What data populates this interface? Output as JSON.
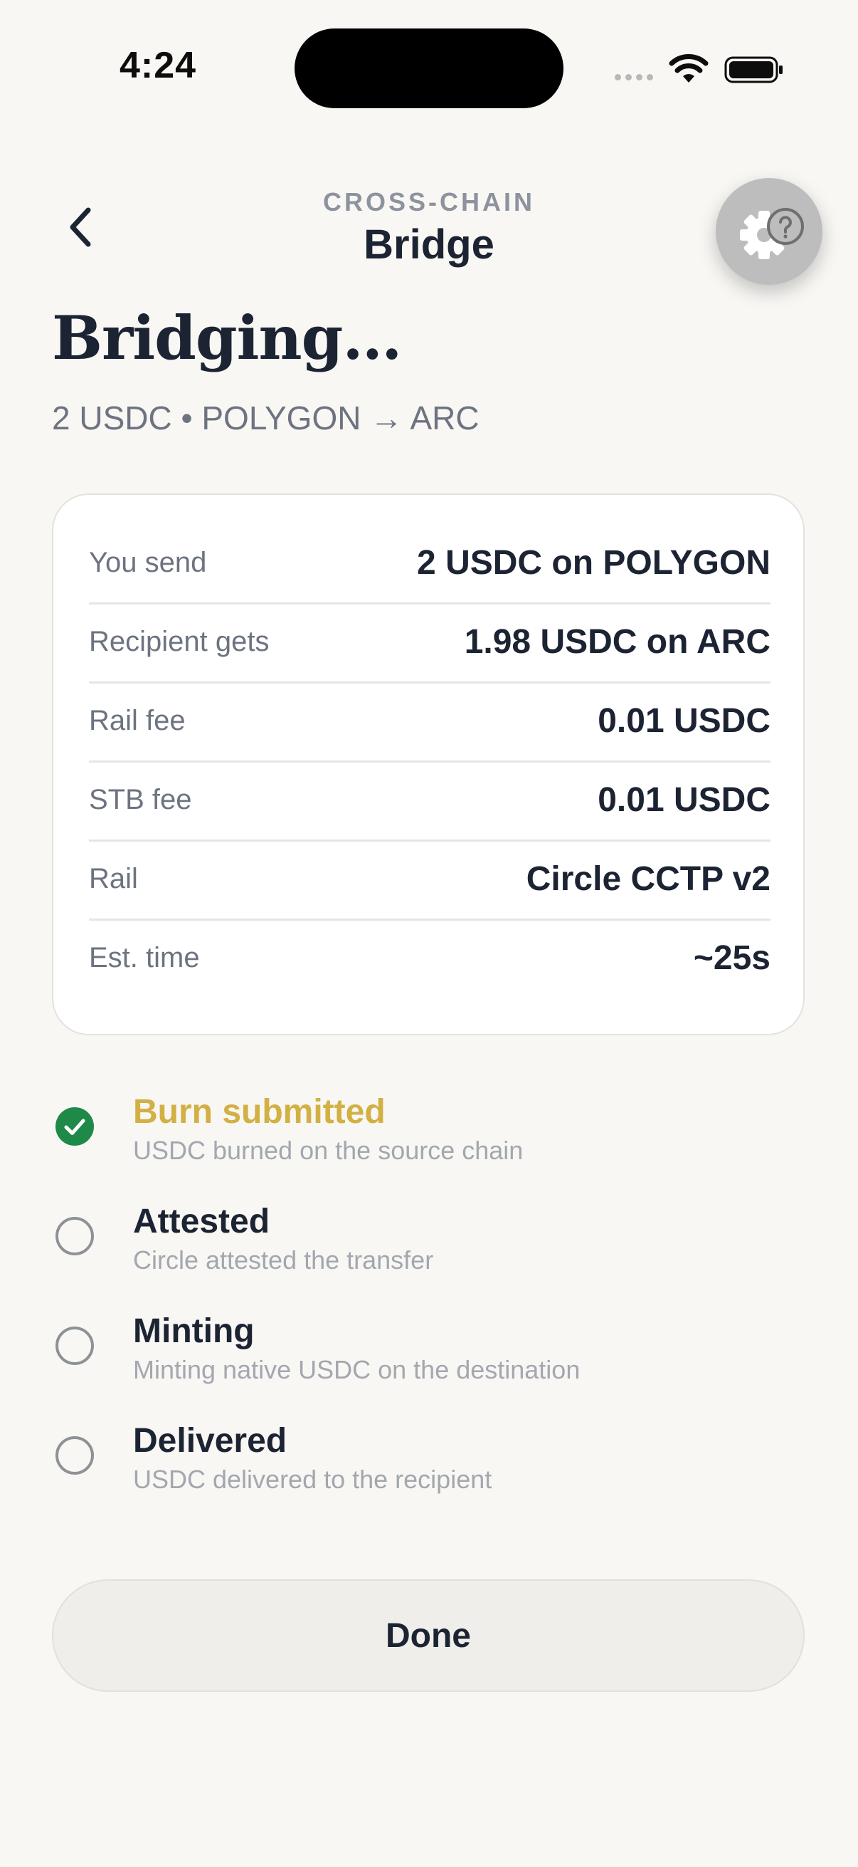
{
  "status_bar": {
    "time": "4:24"
  },
  "header": {
    "eyebrow": "CROSS-CHAIN",
    "title": "Bridge",
    "back_icon": "chevron-left-icon",
    "settings_icon": "gear-help-icon"
  },
  "page": {
    "heading": "Bridging…",
    "subtitle": "2 USDC • POLYGON → ARC"
  },
  "summary": {
    "rows": [
      {
        "label": "You send",
        "value": "2 USDC on POLYGON"
      },
      {
        "label": "Recipient gets",
        "value": "1.98 USDC on ARC"
      },
      {
        "label": "Rail fee",
        "value": "0.01 USDC"
      },
      {
        "label": "STB fee",
        "value": "0.01 USDC"
      },
      {
        "label": "Rail",
        "value": "Circle CCTP v2"
      },
      {
        "label": "Est. time",
        "value": "~25s"
      }
    ]
  },
  "steps": [
    {
      "title": "Burn submitted",
      "description": "USDC burned on the source chain",
      "state": "complete"
    },
    {
      "title": "Attested",
      "description": "Circle attested the transfer",
      "state": "pending"
    },
    {
      "title": "Minting",
      "description": "Minting native USDC on the destination",
      "state": "pending"
    },
    {
      "title": "Delivered",
      "description": "USDC delivered to the recipient",
      "state": "pending"
    }
  ],
  "actions": {
    "done_label": "Done"
  },
  "colors": {
    "background": "#f8f7f4",
    "text_primary": "#1c2433",
    "text_muted": "#6d7380",
    "step_complete_text": "#d3b043",
    "check_green": "#1f8a47"
  }
}
